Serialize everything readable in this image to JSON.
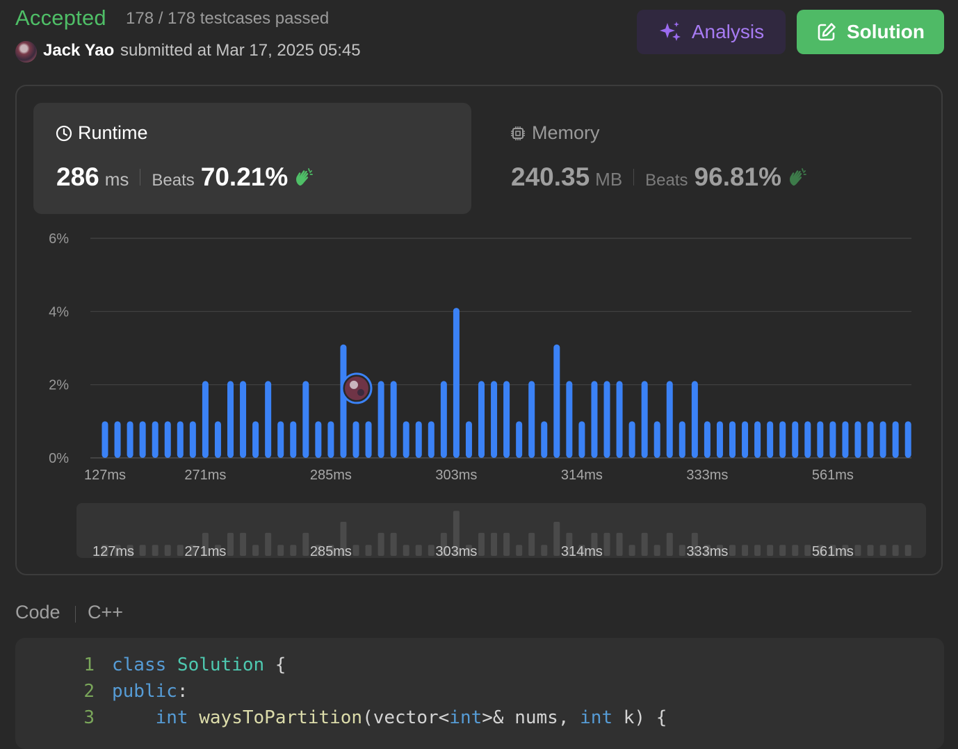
{
  "header": {
    "status": "Accepted",
    "testcases": "178 / 178 testcases passed",
    "submitter": "Jack Yao",
    "submitted_at": "submitted at Mar 17, 2025 05:45",
    "analysis_label": "Analysis",
    "solution_label": "Solution"
  },
  "runtime": {
    "title": "Runtime",
    "value": "286",
    "unit": "ms",
    "beats_label": "Beats",
    "beats_pct": "70.21%"
  },
  "memory": {
    "title": "Memory",
    "value": "240.35",
    "unit": "MB",
    "beats_label": "Beats",
    "beats_pct": "96.81%"
  },
  "colors": {
    "accepted": "#4fbf67",
    "bar": "#3b82f6",
    "analysis": "#a77bf3",
    "solution_bg": "#4fba66"
  },
  "chart_data": {
    "type": "bar",
    "yticks": [
      "6%",
      "4%",
      "2%",
      "0%"
    ],
    "ylim": [
      0,
      6
    ],
    "xtick_labels": [
      "127ms",
      "271ms",
      "285ms",
      "303ms",
      "314ms",
      "333ms",
      "561ms"
    ],
    "xtick_bar_index": [
      0,
      8,
      18,
      28,
      38,
      48,
      58
    ],
    "values": [
      1.0,
      1.0,
      1.0,
      1.0,
      1.0,
      1.0,
      1.0,
      1.0,
      2.1,
      1.0,
      2.1,
      2.1,
      1.0,
      2.1,
      1.0,
      1.0,
      2.1,
      1.0,
      1.0,
      3.1,
      1.0,
      1.0,
      2.1,
      2.1,
      1.0,
      1.0,
      1.0,
      2.1,
      4.1,
      1.0,
      2.1,
      2.1,
      2.1,
      1.0,
      2.1,
      1.0,
      3.1,
      2.1,
      1.0,
      2.1,
      2.1,
      2.1,
      1.0,
      2.1,
      1.0,
      2.1,
      1.0,
      2.1,
      1.0,
      1.0,
      1.0,
      1.0,
      1.0,
      1.0,
      1.0,
      1.0,
      1.0,
      1.0,
      1.0,
      1.0,
      1.0,
      1.0,
      1.0,
      1.0,
      1.0
    ],
    "marker_bar_index": 20,
    "grid": true
  },
  "code": {
    "tab": "Code",
    "language": "C++",
    "lines": [
      {
        "n": "1",
        "parts": [
          [
            "kw",
            "class "
          ],
          [
            "ty",
            "Solution"
          ],
          [
            "",
            " {"
          ]
        ]
      },
      {
        "n": "2",
        "parts": [
          [
            "kw",
            "public"
          ],
          [
            "",
            ":"
          ]
        ]
      },
      {
        "n": "3",
        "parts": [
          [
            "",
            "    "
          ],
          [
            "kw",
            "int "
          ],
          [
            "fn",
            "waysToPartition"
          ],
          [
            "",
            "(vector<"
          ],
          [
            "kw",
            "int"
          ],
          [
            "",
            ">& nums, "
          ],
          [
            "kw",
            "int"
          ],
          [
            "",
            " k) {"
          ]
        ]
      }
    ]
  }
}
